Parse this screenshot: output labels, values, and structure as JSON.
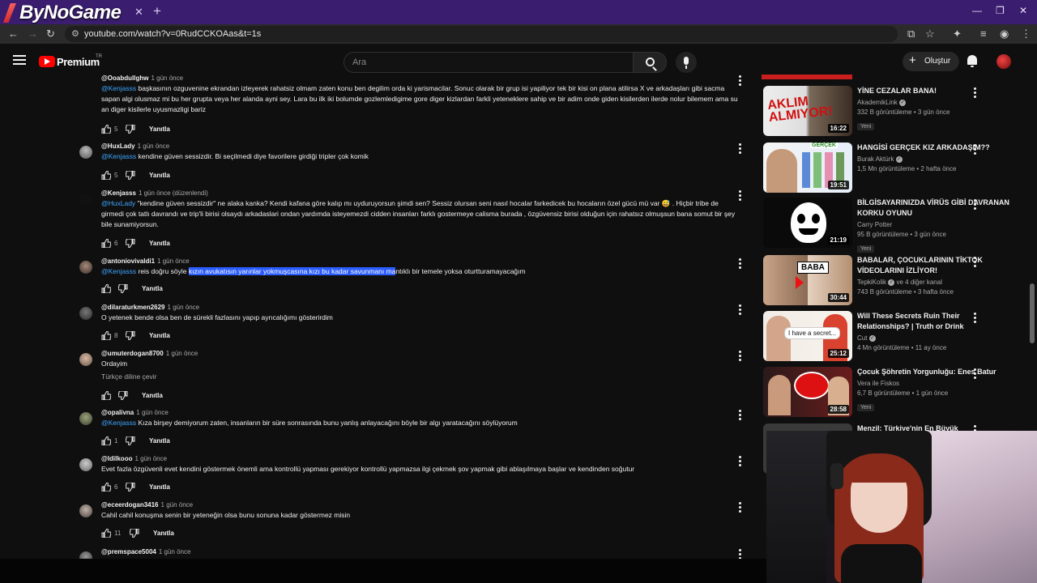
{
  "browser": {
    "logo_text": "ByNoGame",
    "url": "youtube.com/watch?v=0RudCCKOAas&t=1s",
    "tab_close": "✕",
    "new_tab": "+"
  },
  "youtube": {
    "brand": "Premium",
    "country": "TR",
    "search_placeholder": "Ara",
    "create_label": "Oluştur"
  },
  "comments": [
    {
      "author": "@Ooabdullghw",
      "time": "1 gün önce",
      "mention": "@Kenjasss",
      "text": " başkasının ozguvenine ekrandan izleyerek rahatsiz olmam zaten konu ben degilim orda ki yarismacilar. Sonuc olarak bir grup isi yapiliyor tek bir kisi on plana atilirsa X ve arkadaşları gibi sacma sapan algi olusmaz mi bu her grupta veya her alanda ayni sey. Lara bu ilk iki bolumde gozlemledigime gore diger kizlardan farkli yeteneklere sahip ve bir adim onde giden kisilerden ilerde nolur bilemem ama su an diger kisilerle uyusmazligi bariz",
      "likes": "5",
      "reply": "Yanıtla"
    },
    {
      "author": "@HuxLady",
      "time": "1 gün önce",
      "mention": "@Kenjasss",
      "text": " kendine güven sessizdir. Bi seçilmedi diye favorilere girdiği tripler çok komik",
      "likes": "5",
      "reply": "Yanıtla"
    },
    {
      "author": "@Kenjasss",
      "time": "1 gün önce (düzenlendi)",
      "mention": "@HuxLady",
      "text": " \"kendine güven sessizdir\" ne alaka kanka? Kendi kafana göre kalıp mı uyduruyorsun şimdi sen? Sessiz olursan seni nasıl hocalar farkedicek bu hocaların özel gücü mü var 😅 . Hiçbir tribe de girmedi çok tatlı davrandı ve trip'li birisi olsaydı arkadaslari ondan yardımda isteyemezdi cidden insanları farklı gostermeye calisma burada , özgüvensiz birisi olduğun için rahatsız olmuşsun bana somut bir şey bile sunamiyorsun.",
      "likes": "6",
      "reply": "Yanıtla"
    },
    {
      "author": "@antoniovivaldi1",
      "time": "1 gün önce",
      "mention": "@Kenjasss",
      "text_before": " reis doğru söyle ",
      "text_highlight": "kızın avukatısın yarınlar yokmuşcasına kızı bu kadar savunmanı ma",
      "text_after": "ntıklı bir temele yoksa oturtturamayacağım",
      "likes": "",
      "reply": "Yanıtla"
    },
    {
      "author": "@dilaraturkmen2629",
      "time": "1 gün önce",
      "text": "O yetenek bende olsa ben de sürekli fazlasını yapıp ayrıcalığımı gösterirdim",
      "likes": "8",
      "reply": "Yanıtla"
    },
    {
      "author": "@umuterdogan8700",
      "time": "1 gün önce",
      "text": "Ordayim",
      "translate": "Türkçe diline çevir",
      "likes": "",
      "reply": "Yanıtla"
    },
    {
      "author": "@opalivna",
      "time": "1 gün önce",
      "mention": "@Kenjasss",
      "text": " Kıza birşey demiyorum zaten, insanların bir süre sonrasında bunu yanlış anlayacağını böyle bir algı yaratacağını söylüyorum",
      "likes": "1",
      "reply": "Yanıtla"
    },
    {
      "author": "@ldilkooo",
      "time": "1 gün önce",
      "text": "Evet fazla özgüvenli evet kendini göstermek önemli ama kontrollü yapması gerekiyor kontrollü yapmazsa ilgi çekmek şov yapmak gibi ablaşılmaya başlar ve kendinden soğutur",
      "likes": "6",
      "reply": "Yanıtla"
    },
    {
      "author": "@eceerdogan3416",
      "time": "1 gün önce",
      "text": "Cahil cahil konuşma senin bir yeteneğin olsa bunu sonuna kadar göstermez misin",
      "likes": "11",
      "reply": "Yanıtla"
    },
    {
      "author": "@premspace5004",
      "time": "1 gün önce"
    }
  ],
  "videos": [
    {
      "title": "YİNE CEZALAR BANA!",
      "channel": "AkademikLink",
      "views": "332 B görüntüleme",
      "age": "3 gün önce",
      "badge": "Yeni",
      "duration": "16:22",
      "thumb_text": "AKLIM ALMIYOR!"
    },
    {
      "title": "HANGİSİ GERÇEK KIZ ARKADAŞIM??",
      "channel": "Burak Aktürk",
      "views": "1,5 Mn görüntüleme",
      "age": "2 hafta önce",
      "duration": "19:51",
      "thumb_text": "GERÇEK"
    },
    {
      "title": "BİLGİSAYARINIZDA VİRÜS GİBİ DAVRANAN KORKU OYUNU",
      "channel": "Carry Potter",
      "views": "95 B görüntüleme",
      "age": "3 gün önce",
      "badge": "Yeni",
      "duration": "21:19"
    },
    {
      "title": "BABALAR, ÇOCUKLARININ TİKTOK VİDEOLARINI İZLİYOR!",
      "channel": "TepkiKolik",
      "channel_extra": "ve 4 diğer kanal",
      "views": "743 B görüntüleme",
      "age": "3 hafta önce",
      "duration": "30:44",
      "thumb_text": "BABA"
    },
    {
      "title": "Will These Secrets Ruin Their Relationships? | Truth or Drink",
      "channel": "Cut",
      "views": "4 Mn görüntüleme",
      "age": "11 ay önce",
      "duration": "25:12",
      "thumb_text": "I have a secret..."
    },
    {
      "title": "Çocuk Şöhretin Yorgunluğu: Enes Batur",
      "channel": "Vera ile Fiskos",
      "views": "6,7 B görüntüleme",
      "age": "1 gün önce",
      "badge": "Yeni",
      "duration": "28:58"
    },
    {
      "title": "Menzil: Türkiye'nin En Büyük"
    }
  ],
  "colors": {
    "background": "#0f0f0f",
    "mention": "#3ea6ff",
    "highlight": "#2a5cff",
    "browser_tabbar": "#3a1d6e"
  }
}
